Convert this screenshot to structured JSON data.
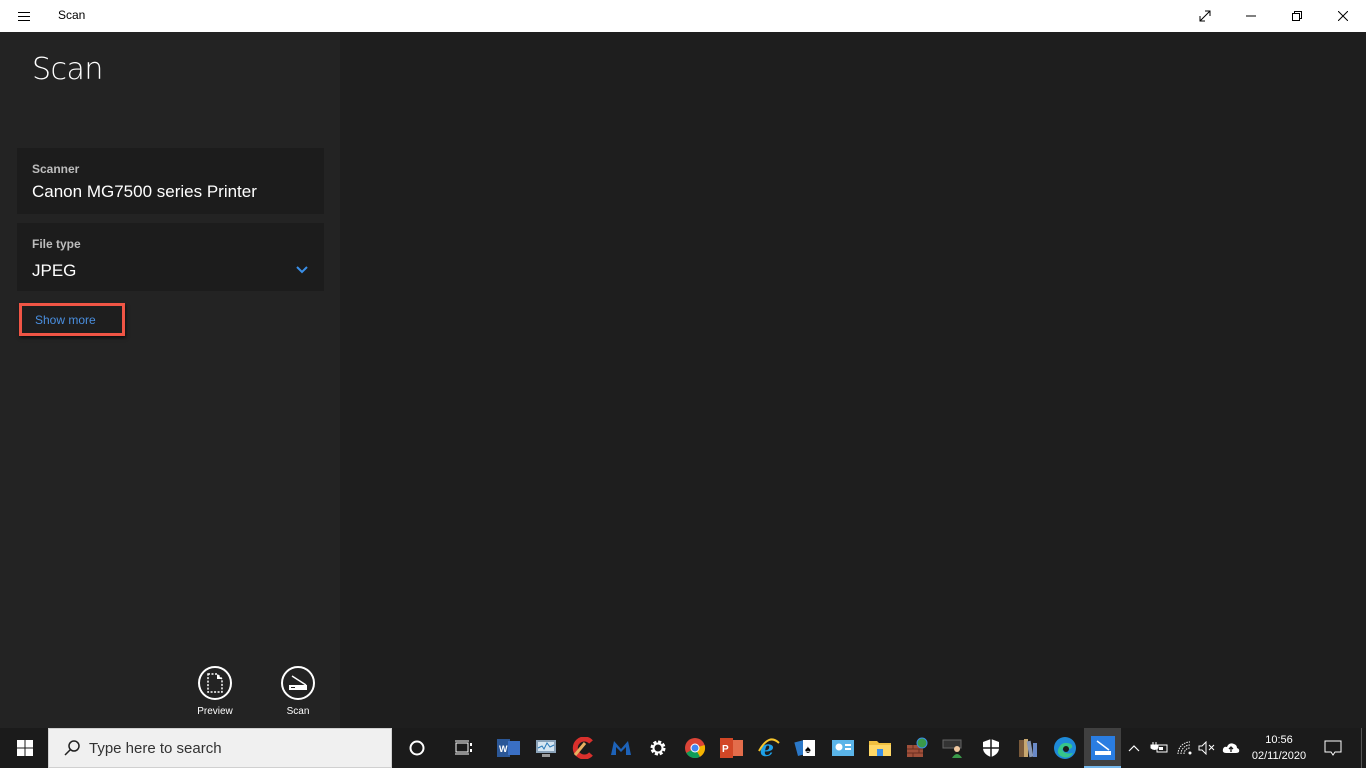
{
  "window": {
    "title": "Scan",
    "controls": [
      "expand",
      "minimize",
      "restore",
      "close"
    ]
  },
  "sidebar": {
    "heading": "Scan",
    "scanner": {
      "label": "Scanner",
      "value": "Canon MG7500 series Printer"
    },
    "file_type": {
      "label": "File type",
      "value": "JPEG"
    },
    "show_more": "Show more",
    "actions": [
      {
        "label": "Preview",
        "icon": "preview-icon"
      },
      {
        "label": "Scan",
        "icon": "scan-icon"
      }
    ]
  },
  "taskbar": {
    "search_placeholder": "Type here to search",
    "pinned": [
      "word",
      "performance-monitor",
      "ccleaner",
      "malwarebytes",
      "settings",
      "chrome",
      "powerpoint",
      "internet-explorer",
      "solitaire",
      "control-panel",
      "file-explorer",
      "firewall",
      "network-user",
      "windows-security",
      "library",
      "edge",
      "scan"
    ],
    "active_app": "scan",
    "clock": {
      "time": "10:56",
      "date": "02/11/2020"
    }
  },
  "colors": {
    "accent": "#3a8fe8",
    "highlight_border": "#f05545",
    "sidebar_bg": "#232323",
    "main_bg": "#1e1e1e",
    "card_bg": "#1c1c1c"
  }
}
